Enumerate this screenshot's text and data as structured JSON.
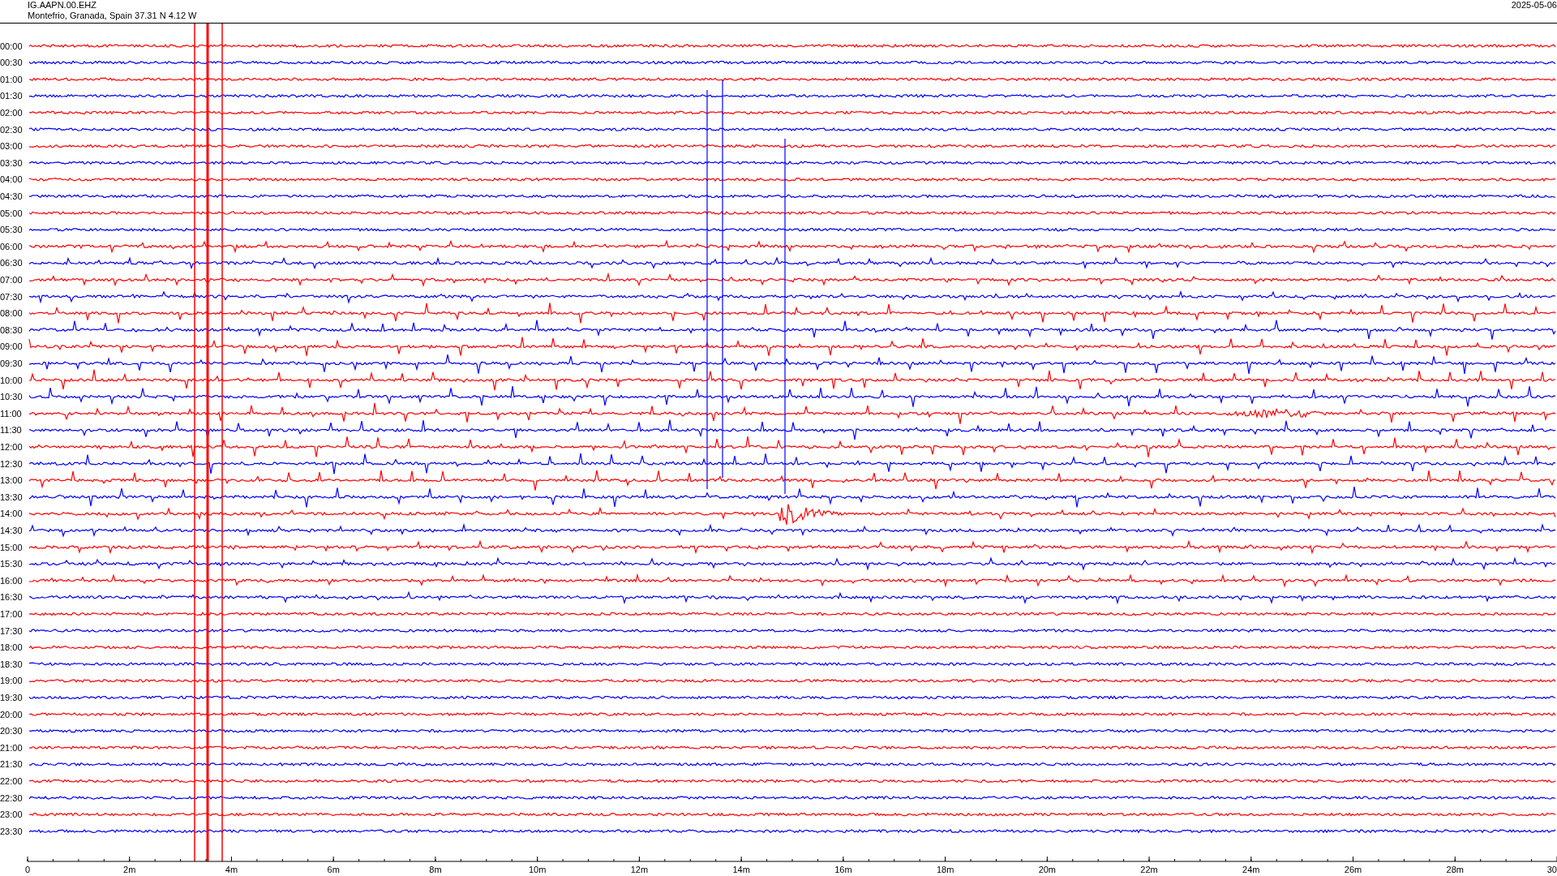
{
  "header": {
    "station": "IG.AAPN.00.EHZ",
    "location": "Montefrio, Granada, Spain  37.31 N 4.12 W",
    "date": "2025-05-06"
  },
  "traces": [
    {
      "time": "00:00",
      "color": "#ff0000"
    },
    {
      "time": "00:30",
      "color": "#0000ff"
    },
    {
      "time": "01:00",
      "color": "#ff0000"
    },
    {
      "time": "01:30",
      "color": "#0000ff"
    },
    {
      "time": "02:00",
      "color": "#ff0000"
    },
    {
      "time": "02:30",
      "color": "#0000ff"
    },
    {
      "time": "03:00",
      "color": "#ff0000"
    },
    {
      "time": "03:30",
      "color": "#0000ff"
    },
    {
      "time": "04:00",
      "color": "#ff0000"
    },
    {
      "time": "04:30",
      "color": "#0000ff"
    },
    {
      "time": "05:00",
      "color": "#ff0000"
    },
    {
      "time": "05:30",
      "color": "#0000ff"
    },
    {
      "time": "06:00",
      "color": "#ff0000"
    },
    {
      "time": "06:30",
      "color": "#0000ff"
    },
    {
      "time": "07:00",
      "color": "#ff0000"
    },
    {
      "time": "07:30",
      "color": "#0000ff"
    },
    {
      "time": "08:00",
      "color": "#ff0000"
    },
    {
      "time": "08:30",
      "color": "#0000ff"
    },
    {
      "time": "09:00",
      "color": "#ff0000"
    },
    {
      "time": "09:30",
      "color": "#0000ff"
    },
    {
      "time": "10:00",
      "color": "#ff0000"
    },
    {
      "time": "10:30",
      "color": "#0000ff"
    },
    {
      "time": "11:00",
      "color": "#ff0000"
    },
    {
      "time": "11:30",
      "color": "#0000ff"
    },
    {
      "time": "12:00",
      "color": "#ff0000"
    },
    {
      "time": "12:30",
      "color": "#0000ff"
    },
    {
      "time": "13:00",
      "color": "#ff0000"
    },
    {
      "time": "13:30",
      "color": "#0000ff"
    },
    {
      "time": "14:00",
      "color": "#ff0000"
    },
    {
      "time": "14:30",
      "color": "#0000ff"
    },
    {
      "time": "15:00",
      "color": "#ff0000"
    },
    {
      "time": "15:30",
      "color": "#0000ff"
    },
    {
      "time": "16:00",
      "color": "#ff0000"
    },
    {
      "time": "16:30",
      "color": "#0000ff"
    },
    {
      "time": "17:00",
      "color": "#ff0000"
    },
    {
      "time": "17:30",
      "color": "#0000ff"
    },
    {
      "time": "18:00",
      "color": "#ff0000"
    },
    {
      "time": "18:30",
      "color": "#0000ff"
    },
    {
      "time": "19:00",
      "color": "#ff0000"
    },
    {
      "time": "19:30",
      "color": "#0000ff"
    },
    {
      "time": "20:00",
      "color": "#ff0000"
    },
    {
      "time": "20:30",
      "color": "#0000ff"
    },
    {
      "time": "21:00",
      "color": "#ff0000"
    },
    {
      "time": "21:30",
      "color": "#0000ff"
    },
    {
      "time": "22:00",
      "color": "#ff0000"
    },
    {
      "time": "22:30",
      "color": "#0000ff"
    },
    {
      "time": "23:00",
      "color": "#ff0000"
    },
    {
      "time": "23:30",
      "color": "#0000ff"
    }
  ],
  "x_axis_labels": [
    "0",
    "2m",
    "4m",
    "6m",
    "8m",
    "10m",
    "12m",
    "14m",
    "16m",
    "18m",
    "20m",
    "22m",
    "24m",
    "26m",
    "28m",
    "30"
  ]
}
